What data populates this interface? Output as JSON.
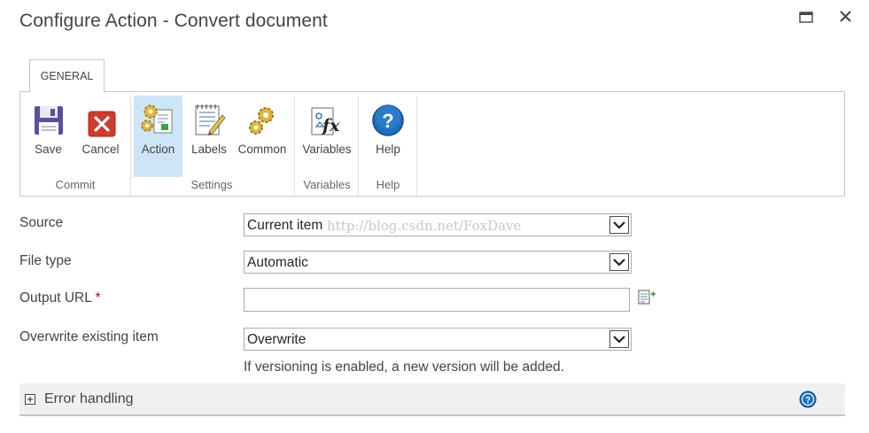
{
  "dialog": {
    "title": "Configure Action - Convert document",
    "maximize_icon": "maximize-icon",
    "close_icon": "close-icon"
  },
  "ribbon": {
    "tab": "GENERAL",
    "groups": {
      "commit": "Commit",
      "settings": "Settings",
      "variables": "Variables",
      "help": "Help"
    },
    "buttons": {
      "save": {
        "label": "Save",
        "icon": "floppy-disk-icon"
      },
      "cancel": {
        "label": "Cancel",
        "icon": "red-x-icon"
      },
      "action": {
        "label": "Action",
        "icon": "gears-document-icon",
        "selected": true
      },
      "labels": {
        "label": "Labels",
        "icon": "notepad-pencil-icon"
      },
      "common": {
        "label": "Common",
        "icon": "gears-icon"
      },
      "variables": {
        "label": "Variables",
        "icon": "fx-variables-icon"
      },
      "help": {
        "label": "Help",
        "icon": "question-circle-icon"
      }
    }
  },
  "form": {
    "source": {
      "label": "Source",
      "value": "Current item"
    },
    "file_type": {
      "label": "File type",
      "value": "Automatic"
    },
    "output_url": {
      "label": "Output URL",
      "required_marker": "*",
      "value": ""
    },
    "overwrite": {
      "label": "Overwrite existing item",
      "value": "Overwrite",
      "hint": "If versioning is enabled, a new version will be added."
    }
  },
  "watermark": "http://blog.csdn.net/FoxDave",
  "error_handling": {
    "label": "Error handling",
    "expand_icon": "plus-box-icon",
    "help_icon": "help-circle-icon"
  },
  "colors": {
    "accent": "#cde6f7",
    "help_blue": "#1c6fbd",
    "cancel_red": "#d23b2b",
    "required": "#c00000"
  }
}
